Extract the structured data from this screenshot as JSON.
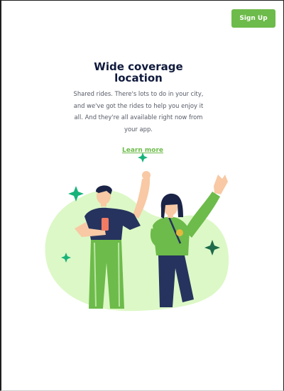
{
  "header": {
    "signup_label": "Sign Up"
  },
  "hero": {
    "title": "Wide coverage location",
    "subtitle": "Shared rides. There's lots to do in your city, and we've got the rides to help you enjoy it all. And they're all available right now from your app.",
    "learn_more": "Learn more"
  },
  "colors": {
    "accent": "#6dbb4a",
    "title": "#0f1a3c",
    "blob": "#dcf8c6",
    "navy": "#26335e",
    "sparkle": "#16b37a"
  },
  "icons": [
    "sparkle-icon"
  ]
}
